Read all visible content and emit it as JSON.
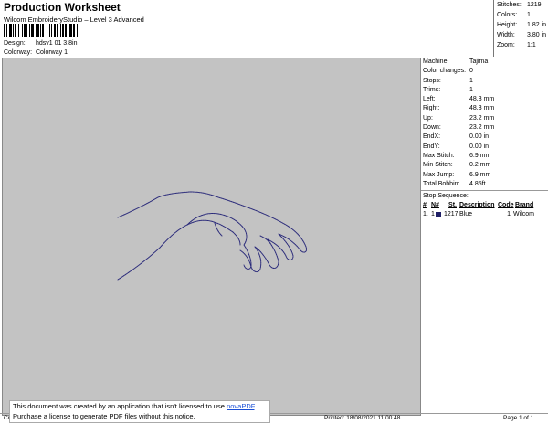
{
  "header": {
    "title": "Production Worksheet",
    "subtitle": "Wilcom EmbroideryStudio – Level 3 Advanced",
    "design_label": "Design:",
    "design_value": "hdsv1 01 3.8in",
    "colorway_label": "Colorway:",
    "colorway_value": "Colorway 1"
  },
  "stats": [
    {
      "label": "Stitches:",
      "value": "1219"
    },
    {
      "label": "Colors:",
      "value": "1"
    },
    {
      "label": "Height:",
      "value": "1.82 in"
    },
    {
      "label": "Width:",
      "value": "3.80 in"
    },
    {
      "label": "Zoom:",
      "value": "1:1"
    }
  ],
  "details": [
    {
      "label": "Machine:",
      "value": "Tajima"
    },
    {
      "label": "Color changes:",
      "value": "0"
    },
    {
      "label": "Stops:",
      "value": "1"
    },
    {
      "label": "Trims:",
      "value": "1"
    },
    {
      "label": "Left:",
      "value": "48.3 mm"
    },
    {
      "label": "Right:",
      "value": "48.3 mm"
    },
    {
      "label": "Up:",
      "value": "23.2 mm"
    },
    {
      "label": "Down:",
      "value": "23.2 mm"
    },
    {
      "label": "EndX:",
      "value": "0.00 in"
    },
    {
      "label": "EndY:",
      "value": "0.00 in"
    },
    {
      "label": "Max Stitch:",
      "value": "6.9 mm"
    },
    {
      "label": "Min Stitch:",
      "value": "0.2 mm"
    },
    {
      "label": "Max Jump:",
      "value": "6.9 mm"
    },
    {
      "label": "Total Bobbin:",
      "value": "4.85ft"
    }
  ],
  "stop_sequence": {
    "title": "Stop Sequence:",
    "headers": {
      "num": "#",
      "n": "N#",
      "st": "St.",
      "description": "Description",
      "code": "Code",
      "brand": "Brand"
    },
    "rows": [
      {
        "num": "1.",
        "n": "1",
        "color": "#1f1f66",
        "st": "1217",
        "description": "Blue",
        "code": "1",
        "brand": "Wilcom"
      }
    ]
  },
  "footer": {
    "left": "Cr",
    "printed": "Printed: 18/08/2021 11.00.48",
    "page": "Page 1 of 1",
    "notice_line1": "This document was created by an application that isn't licensed to use",
    "notice_link": "novaPDF",
    "notice_line1_end": ".",
    "notice_line2": "Purchase a license to generate PDF files without this notice."
  },
  "colors": {
    "canvas": "#c3c3c3",
    "stitch": "#2a2a7a"
  }
}
